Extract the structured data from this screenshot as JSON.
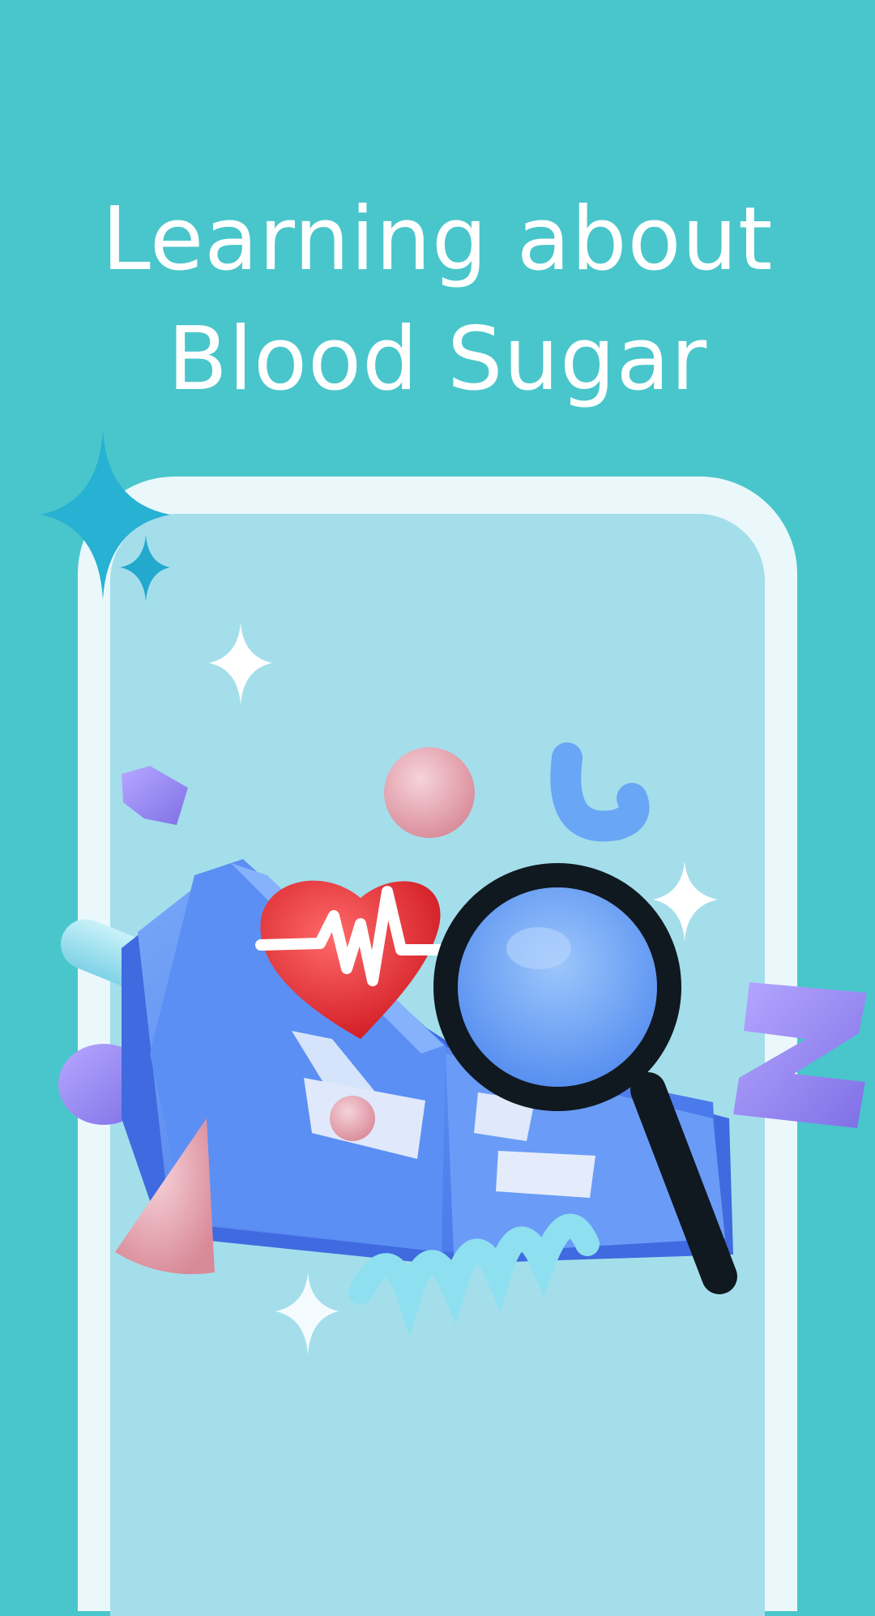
{
  "headline": {
    "line1": "Learning about",
    "line2": "Blood Sugar"
  },
  "colors": {
    "background": "#49c6cb",
    "frame": "#eaf8fb",
    "screen": "#a4deeb",
    "heading_text": "#ffffff",
    "heart": "#e8282c",
    "book": "#4f86f0",
    "magnifier_rim": "#101820",
    "lens": "#6aa4f4",
    "accent_purple": "#9b8cf2",
    "accent_pink": "#e8a8b4"
  },
  "illustration": {
    "subject": "open-book-heart-magnifier",
    "icons": [
      "sparkle-icon",
      "heart-pulse-icon",
      "magnifier-icon",
      "book-icon",
      "letter-z-shape",
      "spring-shape",
      "cone-shape",
      "sphere-shape"
    ]
  }
}
